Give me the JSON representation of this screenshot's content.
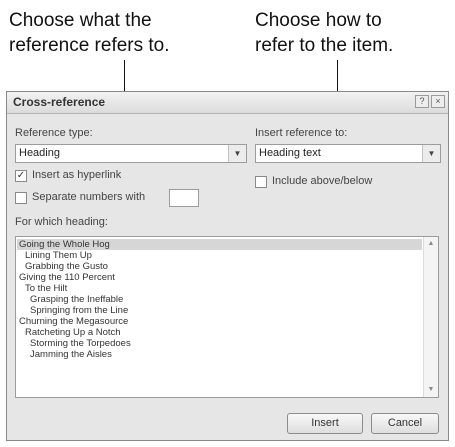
{
  "callouts": {
    "left": [
      "Choose what the",
      "reference refers to."
    ],
    "right": [
      "Choose how to",
      "refer to the item."
    ]
  },
  "dialog": {
    "title": "Cross-reference",
    "help_glyph": "?",
    "close_glyph": "×",
    "reference_type": {
      "label": "Reference type:",
      "value": "Heading"
    },
    "insert_reference_to": {
      "label": "Insert reference to:",
      "value": "Heading text"
    },
    "insert_as_hyperlink": {
      "label": "Insert as hyperlink",
      "checked": true
    },
    "include_above_below": {
      "label": "Include above/below",
      "checked": false
    },
    "separate_numbers": {
      "label": "Separate numbers with",
      "checked": false,
      "value": ""
    },
    "for_which_heading": {
      "label": "For which heading:",
      "items": [
        "Going the Whole Hog",
        "Lining Them Up",
        "Grabbing the Gusto",
        "Giving the 110 Percent",
        "To the Hilt",
        "Grasping the Ineffable",
        "Springing from the Line",
        "Churning the Megasource",
        "Ratcheting Up a Notch",
        "Storming the Torpedoes",
        "Jamming the Aisles"
      ],
      "levels": [
        0,
        1,
        1,
        0,
        1,
        2,
        2,
        0,
        1,
        2,
        2
      ],
      "selected": 0
    },
    "buttons": {
      "insert": "Insert",
      "cancel": "Cancel"
    }
  }
}
